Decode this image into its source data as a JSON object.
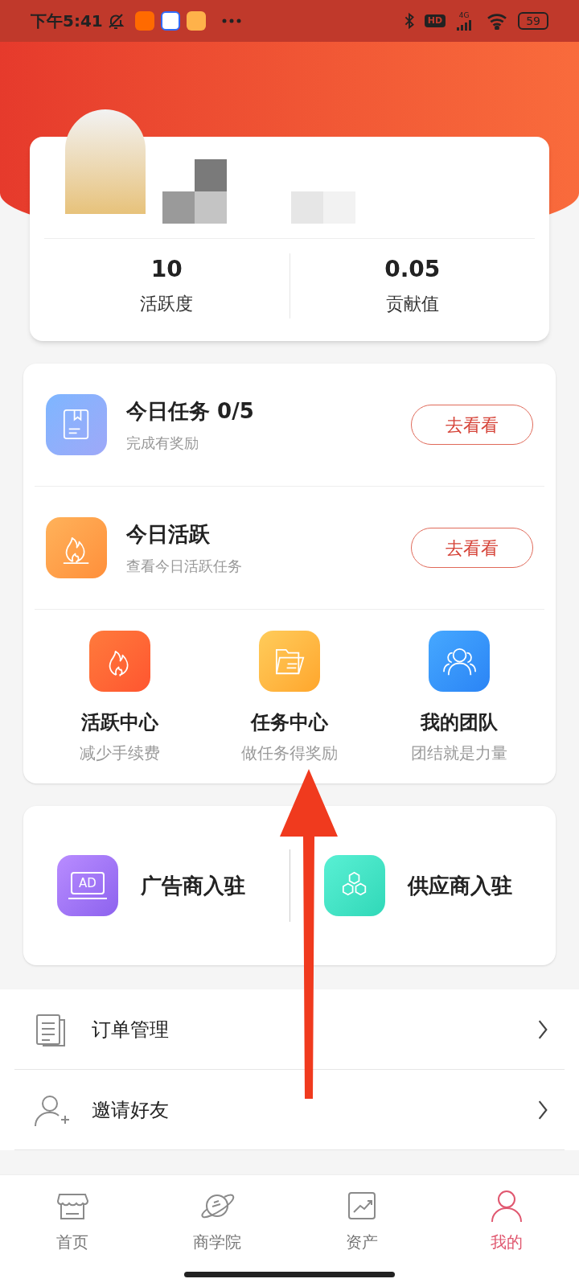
{
  "status_bar": {
    "time": "下午5:41",
    "network": "4G",
    "hd": "HD",
    "battery": "59"
  },
  "profile": {
    "stats": [
      {
        "value": "10",
        "label": "活跃度"
      },
      {
        "value": "0.05",
        "label": "贡献值"
      }
    ]
  },
  "tasks": [
    {
      "kind": "book",
      "title": "今日任务 0/5",
      "subtitle": "完成有奖励",
      "button": "去看看"
    },
    {
      "kind": "fire",
      "title": "今日活跃",
      "subtitle": "查看今日活跃任务",
      "button": "去看看"
    }
  ],
  "shortcuts": [
    {
      "kind": "fire",
      "title": "活跃中心",
      "subtitle": "减少手续费"
    },
    {
      "kind": "folder",
      "title": "任务中心",
      "subtitle": "做任务得奖励"
    },
    {
      "kind": "team",
      "title": "我的团队",
      "subtitle": "团结就是力量"
    }
  ],
  "partners": [
    {
      "kind": "ad",
      "icon_text": "AD",
      "title": "广告商入驻"
    },
    {
      "kind": "hex",
      "title": "供应商入驻"
    }
  ],
  "menu": [
    {
      "kind": "document",
      "label": "订单管理"
    },
    {
      "kind": "user-add",
      "label": "邀请好友"
    }
  ],
  "nav": [
    {
      "kind": "store",
      "label": "首页",
      "selected": false
    },
    {
      "kind": "planet",
      "label": "商学院",
      "selected": false
    },
    {
      "kind": "chart",
      "label": "资产",
      "selected": false
    },
    {
      "kind": "person",
      "label": "我的",
      "selected": true
    }
  ]
}
